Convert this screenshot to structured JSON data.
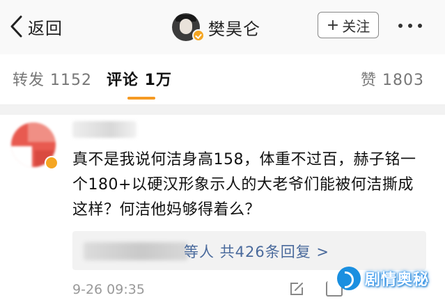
{
  "header": {
    "back_label": "返回",
    "title": "樊昊仑",
    "follow_label": "关注",
    "follow_prefix": "+",
    "icons": [
      "back-chevron-icon",
      "verified-badge-icon",
      "more-dots-icon"
    ]
  },
  "tabs": [
    {
      "label": "转发 1152",
      "active": false
    },
    {
      "label": "评论 1万",
      "active": true
    },
    {
      "label": "赞 1803",
      "active": false
    }
  ],
  "comment": {
    "text": "真不是我说何洁身高158，体重不过百，赫子铭一个180+以硬汉形象示人的大老爷们能被何洁撕成这样？何洁他妈够得着么？",
    "reply_summary": "等人 共426条回复 >",
    "time": "9-26 09:35"
  },
  "watermark": {
    "text": "剧情奥秘"
  },
  "colors": {
    "accent": "#f59a23",
    "link": "#4a6a9c",
    "watermark": "#1a8fe0"
  }
}
